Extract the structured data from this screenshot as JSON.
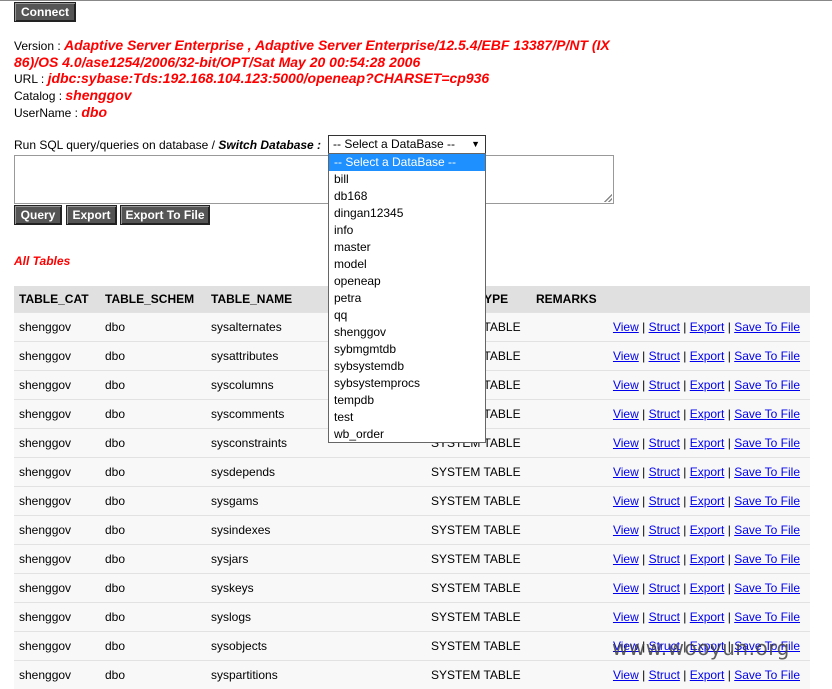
{
  "connect_button": "Connect",
  "info": {
    "version_label": "Version :",
    "version_line1": "Adaptive Server Enterprise , Adaptive Server Enterprise/12.5.4/EBF 13387/P/NT (IX",
    "version_line2": "86)/OS 4.0/ase1254/2006/32-bit/OPT/Sat May 20 00:54:28 2006",
    "url_label": "URL :",
    "url_value": "jdbc:sybase:Tds:192.168.104.123:5000/openeap?CHARSET=cp936",
    "catalog_label": "Catalog :",
    "catalog_value": "shenggov",
    "username_label": "UserName :",
    "username_value": "dbo"
  },
  "sql": {
    "run_label": "Run SQL query/queries on database / ",
    "switch_label": "Switch Database :",
    "select_value": "-- Select a DataBase --",
    "textarea_value": "",
    "query_button": "Query",
    "export_button": "Export",
    "export_file_button": "Export To File"
  },
  "database_options": [
    "-- Select a DataBase --",
    "bill",
    "db168",
    "dingan12345",
    "info",
    "master",
    "model",
    "openeap",
    "petra",
    "qq",
    "shenggov",
    "sybmgmtdb",
    "sybsystemdb",
    "sybsystemprocs",
    "tempdb",
    "test",
    "wb_order"
  ],
  "all_tables_label": "All Tables",
  "table": {
    "headers": [
      "TABLE_CAT",
      "TABLE_SCHEM",
      "TABLE_NAME",
      "TABLE_TYPE",
      "REMARKS"
    ],
    "action_links": [
      "View",
      "Struct",
      "Export",
      "Save To File"
    ],
    "rows": [
      {
        "cat": "shenggov",
        "schem": "dbo",
        "name": "sysalternates",
        "type": "SYSTEM TABLE"
      },
      {
        "cat": "shenggov",
        "schem": "dbo",
        "name": "sysattributes",
        "type": "SYSTEM TABLE"
      },
      {
        "cat": "shenggov",
        "schem": "dbo",
        "name": "syscolumns",
        "type": "SYSTEM TABLE"
      },
      {
        "cat": "shenggov",
        "schem": "dbo",
        "name": "syscomments",
        "type": "SYSTEM TABLE"
      },
      {
        "cat": "shenggov",
        "schem": "dbo",
        "name": "sysconstraints",
        "type": "SYSTEM TABLE"
      },
      {
        "cat": "shenggov",
        "schem": "dbo",
        "name": "sysdepends",
        "type": "SYSTEM TABLE"
      },
      {
        "cat": "shenggov",
        "schem": "dbo",
        "name": "sysgams",
        "type": "SYSTEM TABLE"
      },
      {
        "cat": "shenggov",
        "schem": "dbo",
        "name": "sysindexes",
        "type": "SYSTEM TABLE"
      },
      {
        "cat": "shenggov",
        "schem": "dbo",
        "name": "sysjars",
        "type": "SYSTEM TABLE"
      },
      {
        "cat": "shenggov",
        "schem": "dbo",
        "name": "syskeys",
        "type": "SYSTEM TABLE"
      },
      {
        "cat": "shenggov",
        "schem": "dbo",
        "name": "syslogs",
        "type": "SYSTEM TABLE"
      },
      {
        "cat": "shenggov",
        "schem": "dbo",
        "name": "sysobjects",
        "type": "SYSTEM TABLE"
      },
      {
        "cat": "shenggov",
        "schem": "dbo",
        "name": "syspartitions",
        "type": "SYSTEM TABLE"
      }
    ]
  },
  "watermark": "www.wooyun.org"
}
